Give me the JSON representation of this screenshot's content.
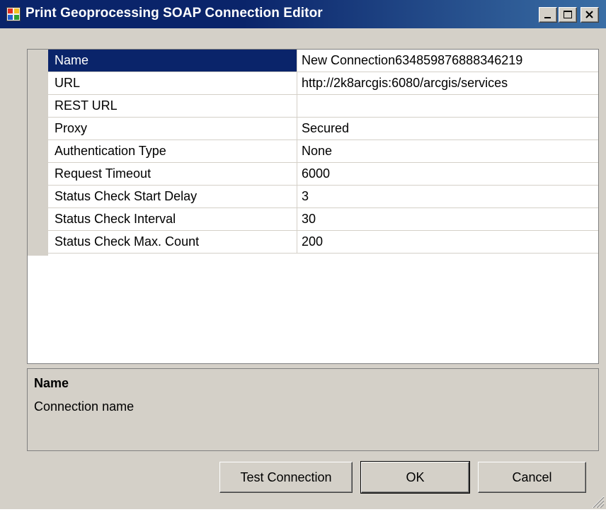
{
  "window": {
    "title": "Print Geoprocessing SOAP Connection Editor"
  },
  "properties": [
    {
      "name": "Name",
      "value": "New Connection634859876888346219"
    },
    {
      "name": "URL",
      "value": "http://2k8arcgis:6080/arcgis/services"
    },
    {
      "name": "REST URL",
      "value": ""
    },
    {
      "name": "Proxy",
      "value": "Secured"
    },
    {
      "name": "Authentication Type",
      "value": "None"
    },
    {
      "name": "Request Timeout",
      "value": "6000"
    },
    {
      "name": "Status Check Start Delay",
      "value": "3"
    },
    {
      "name": "Status Check Interval",
      "value": "30"
    },
    {
      "name": "Status Check Max. Count",
      "value": "200"
    }
  ],
  "selected_property": "Name",
  "help": {
    "title": "Name",
    "description": "Connection name"
  },
  "buttons": {
    "test_connection": "Test Connection",
    "ok": "OK",
    "cancel": "Cancel"
  },
  "colors": {
    "titlebar": "#0a246a",
    "selection": "#0a246a",
    "face": "#d4d0c8"
  },
  "icons": {
    "app": "app-window-icon",
    "minimize": "minimize-icon",
    "maximize": "maximize-icon",
    "close": "close-icon",
    "grip": "resize-grip-icon"
  }
}
